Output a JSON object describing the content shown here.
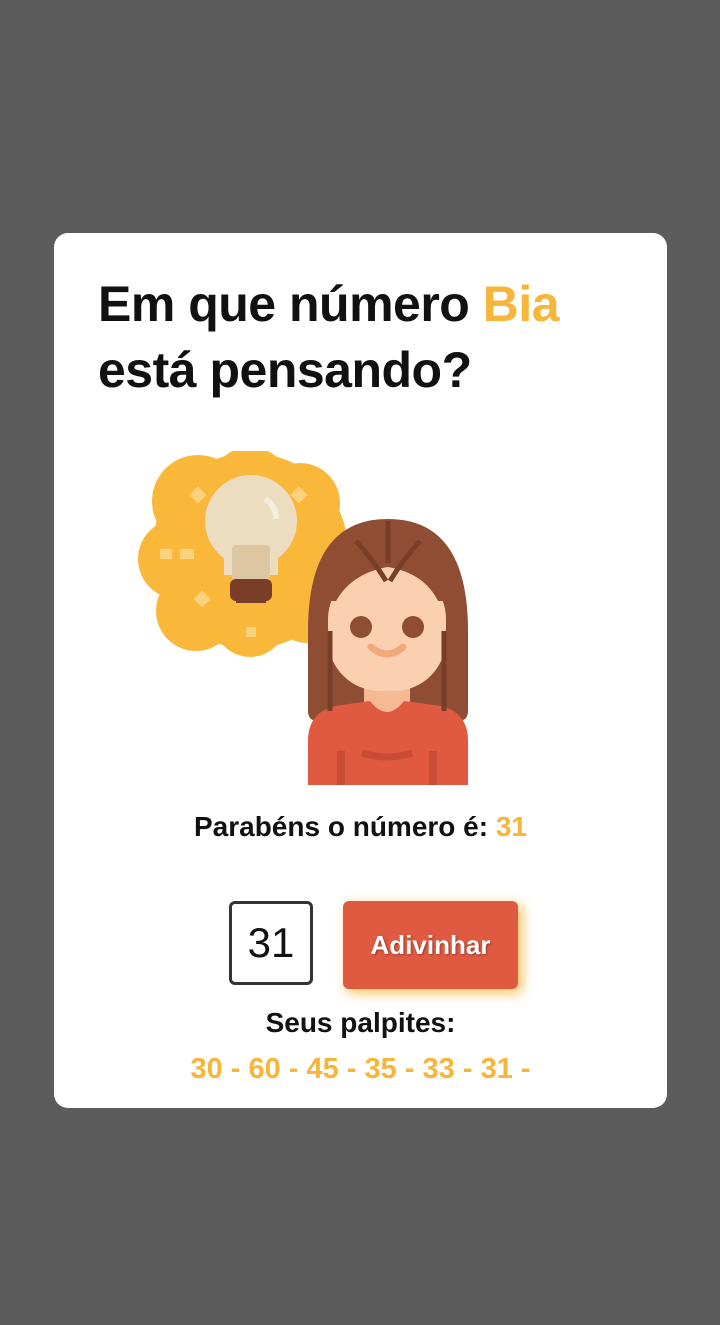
{
  "title": {
    "line1_prefix": "Em que número",
    "name": "Bia",
    "line2": "está pensando?"
  },
  "illustration": {
    "icons": [
      "lightbulb-icon",
      "girl-avatar"
    ]
  },
  "result": {
    "label": "Parabéns o número é:",
    "number": "31"
  },
  "guess": {
    "input_value": "31",
    "button_label": "Adivinhar"
  },
  "history": {
    "label": "Seus palpites:",
    "values": "30 - 60 - 45 - 35 - 33 - 31 -"
  },
  "colors": {
    "background": "#5c5c5c",
    "card": "#ffffff",
    "accent": "#f7b539",
    "button": "#e05a41"
  }
}
